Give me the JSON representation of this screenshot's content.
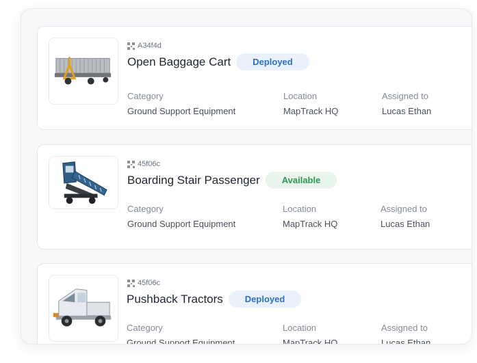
{
  "assets": [
    {
      "id": "A34f4d",
      "name": "Open Baggage Cart",
      "status": "Deployed",
      "status_type": "deployed",
      "image_icon": "baggage-cart-icon",
      "category_label": "Category",
      "category": "Ground Support Equipment",
      "location_label": "Location",
      "location": "MapTrack HQ",
      "assigned_label": "Assigned to",
      "assigned": "Lucas Ethan"
    },
    {
      "id": "45f06c",
      "name": "Boarding Stair Passenger",
      "status": "Available",
      "status_type": "available",
      "image_icon": "boarding-stairs-icon",
      "category_label": "Category",
      "category": "Ground Support Equipment",
      "location_label": "Location",
      "location": "MapTrack HQ",
      "assigned_label": "Assigned to",
      "assigned": "Lucas Ethan"
    },
    {
      "id": "45f06c",
      "name": "Pushback Tractors",
      "status": "Deployed",
      "status_type": "deployed",
      "image_icon": "pushback-tractor-icon",
      "category_label": "Category",
      "category": "Ground Support Equipment",
      "location_label": "Location",
      "location": "MapTrack HQ",
      "assigned_label": "Assigned to",
      "assigned": "Lucas Ethan"
    }
  ],
  "colors": {
    "deployed_bg": "#e8f1fc",
    "deployed_text": "#2f6fc3",
    "available_bg": "#e8f4ec",
    "available_text": "#2f9a55"
  }
}
